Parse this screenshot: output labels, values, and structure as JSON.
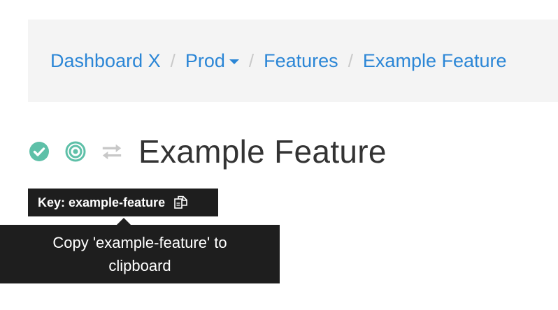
{
  "breadcrumb": {
    "items": [
      {
        "label": "Dashboard X"
      },
      {
        "label": "Prod",
        "has_dropdown": true
      },
      {
        "label": "Features"
      },
      {
        "label": "Example Feature"
      }
    ],
    "separator": "/"
  },
  "feature": {
    "title": "Example Feature",
    "status_icons": [
      "check-circle-icon",
      "target-icon",
      "arrows-swap-icon"
    ],
    "key_label": "Key: example-feature"
  },
  "tooltip": {
    "text": "Copy 'example-feature' to clipboard"
  },
  "colors": {
    "link": "#2b86d6",
    "status_green": "#5ec0a8",
    "muted_icon": "#c8c8c8",
    "dark_bg": "#1e1e1e",
    "breadcrumb_bg": "#f4f4f4"
  }
}
